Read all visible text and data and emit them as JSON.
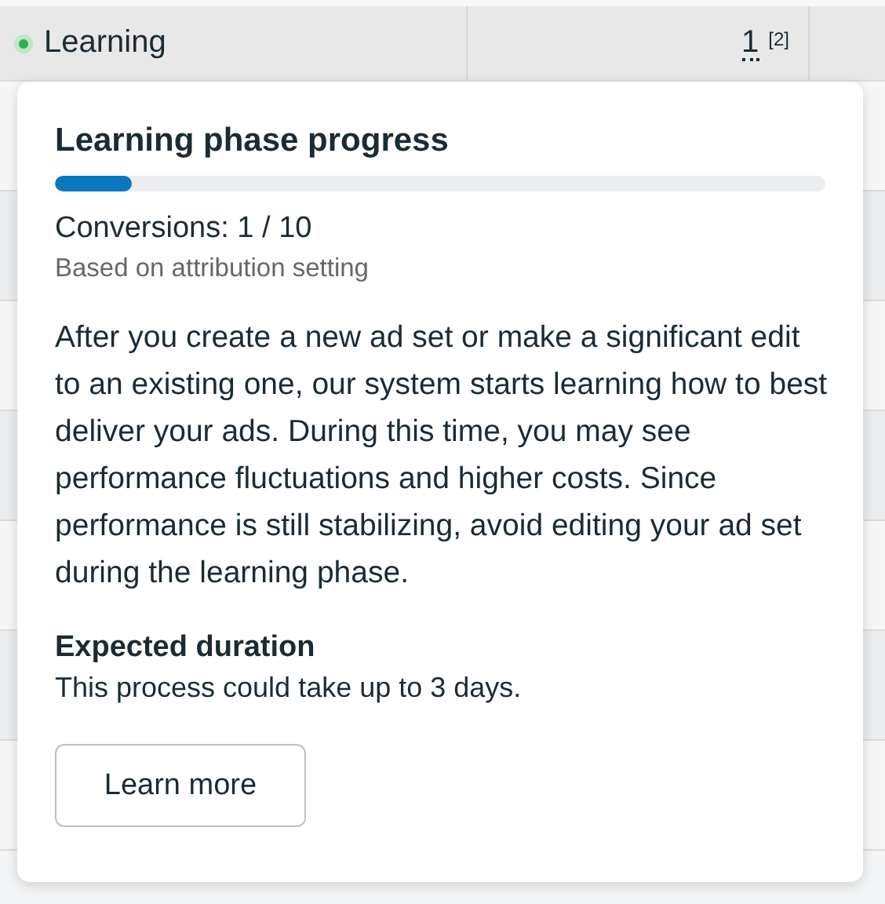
{
  "table_row": {
    "status": "Learning",
    "kind": "learning",
    "count": "1",
    "footnote": "[2]"
  },
  "popover": {
    "title": "Learning phase progress",
    "progress": {
      "level": 0.1
    },
    "conversions": "Conversions: 1 / 10",
    "note": "Based on attribution setting",
    "body": "After you create a new ad set or make a significant edit to an existing one, our system starts learning how to best deliver your ads. During this time, you may see performance fluctuations and higher costs. Since performance is still stabilizing, avoid editing your ad set during the learning phase.",
    "duration_title": "Expected duration",
    "duration_text": "This process could take up to 3 days.",
    "button": "Learn more"
  }
}
